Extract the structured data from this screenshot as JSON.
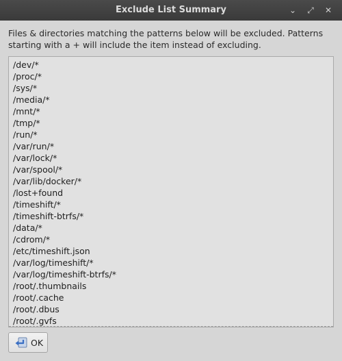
{
  "window": {
    "title": "Exclude List Summary",
    "controls": {
      "minimize": "⌄",
      "maximize": "⤢",
      "close": "✕"
    }
  },
  "description": "Files & directories matching the patterns below will be excluded. Patterns starting with a + will include the item instead of excluding.",
  "patterns": [
    "/dev/*",
    "/proc/*",
    "/sys/*",
    "/media/*",
    "/mnt/*",
    "/tmp/*",
    "/run/*",
    "/var/run/*",
    "/var/lock/*",
    "/var/spool/*",
    "/var/lib/docker/*",
    "/lost+found",
    "/timeshift/*",
    "/timeshift-btrfs/*",
    "/data/*",
    "/cdrom/*",
    "/etc/timeshift.json",
    "/var/log/timeshift/*",
    "/var/log/timeshift-btrfs/*",
    "/root/.thumbnails",
    "/root/.cache",
    "/root/.dbus",
    "/root/.gvfs"
  ],
  "ok_button": {
    "label": "OK",
    "icon": "return-arrow-icon"
  },
  "colors": {
    "titlebar": "#3f3f3f",
    "background": "#d6d6d6",
    "list_background": "#e1e1e1",
    "icon_blue": "#3a6fc4"
  }
}
